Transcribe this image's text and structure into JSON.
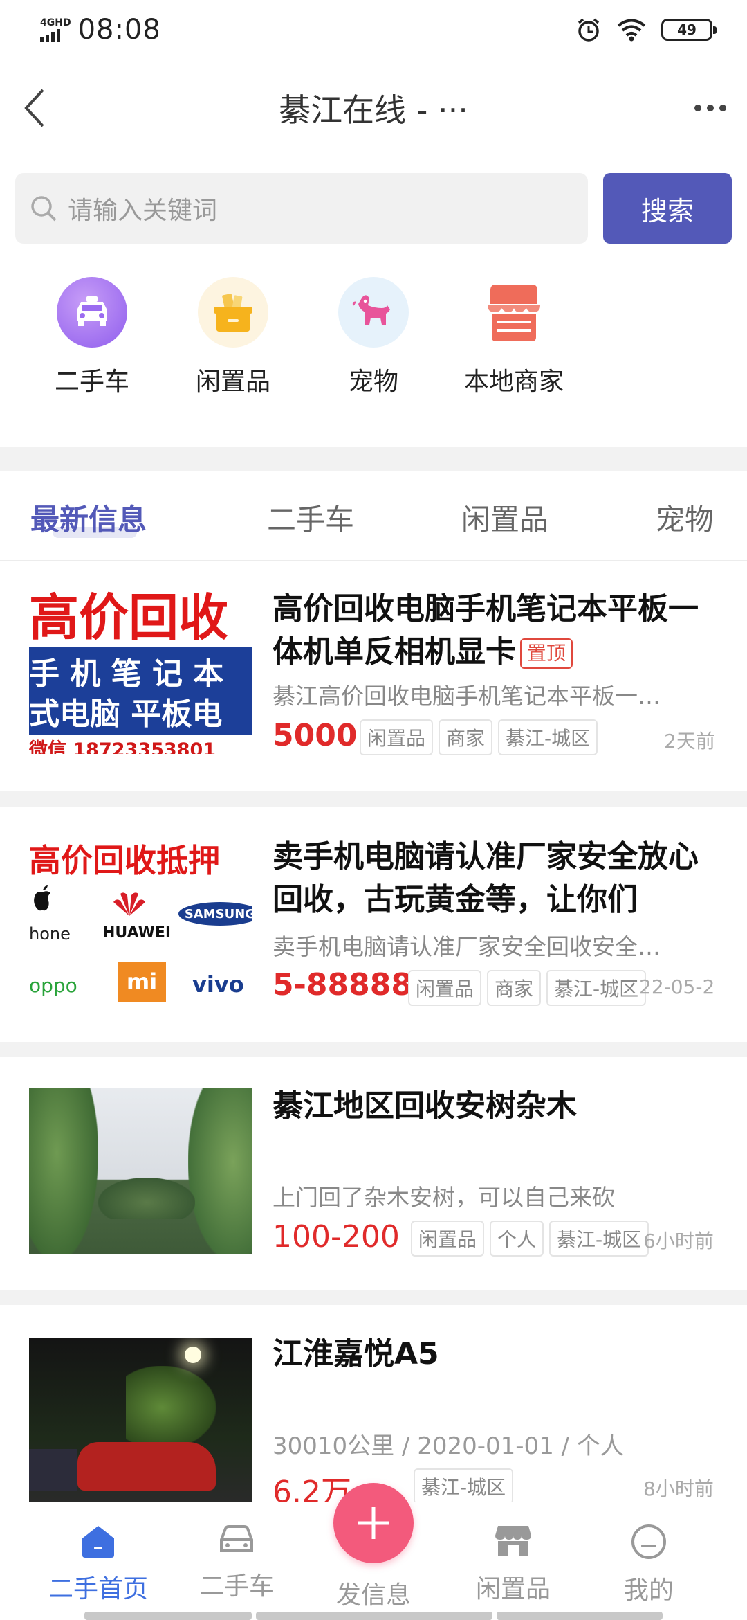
{
  "status_bar": {
    "network": "4GHD",
    "time": "08:08",
    "battery": "49"
  },
  "nav": {
    "title": "綦江在线 - ···"
  },
  "search": {
    "placeholder": "请输入关键词",
    "button": "搜索"
  },
  "categories": [
    {
      "label": "二手车",
      "icon": "taxi-icon",
      "color": "#9b6cf0"
    },
    {
      "label": "闲置品",
      "icon": "box-icon",
      "color": "#f6b31d"
    },
    {
      "label": "宠物",
      "icon": "dog-icon",
      "color": "#e8549a"
    },
    {
      "label": "本地商家",
      "icon": "store-icon",
      "color": "#ef6c5a"
    }
  ],
  "tabs": [
    "最新信息",
    "二手车",
    "闲置品",
    "宠物"
  ],
  "listings": [
    {
      "title": "高价回收电脑手机笔记本平板一体机单反相机显卡",
      "badge": "置顶",
      "desc": "綦江高价回收电脑手机笔记本平板一…",
      "price": "5000",
      "tags": [
        "闲置品",
        "商家",
        "綦江-城区"
      ],
      "time": "2天前",
      "thumb_text": [
        "高价回收",
        "手 机  笔 记 本",
        "式电脑  平板电",
        "微信 18723353801"
      ]
    },
    {
      "title": "卖手机电脑请认准厂家安全放心回收，古玩黄金等，让你们",
      "desc": "卖手机电脑请认准厂家安全回收安全…",
      "price": "5-88888",
      "tags": [
        "闲置品",
        "商家",
        "綦江-城区"
      ],
      "time": "22-05-2",
      "thumb_text": [
        "高价回收抵押",
        "hone",
        "HUAWEI",
        "SAMSUNG",
        "oppo",
        "mi",
        "vivo"
      ]
    },
    {
      "title": "綦江地区回收安树杂木",
      "desc": "上门回了杂木安树，可以自己来砍",
      "price": "100-200",
      "tags": [
        "闲置品",
        "个人",
        "綦江-城区"
      ],
      "time": "6小时前"
    },
    {
      "title": "江淮嘉悦A5",
      "meta": "30010公里 / 2020-01-01 / 个人",
      "price": "6.2万",
      "tags": [
        "綦江-城区"
      ],
      "time": "8小时前"
    }
  ],
  "bottom_nav": [
    {
      "label": "二手首页",
      "icon": "home-icon"
    },
    {
      "label": "二手车",
      "icon": "car-icon"
    },
    {
      "label": "发信息",
      "icon": "plus-icon"
    },
    {
      "label": "闲置品",
      "icon": "shop-icon"
    },
    {
      "label": "我的",
      "icon": "profile-icon"
    }
  ],
  "colors": {
    "accent": "#5359b8",
    "price": "#e02a2a",
    "fab": "#f35a7c",
    "active_nav": "#3e6fe0"
  }
}
